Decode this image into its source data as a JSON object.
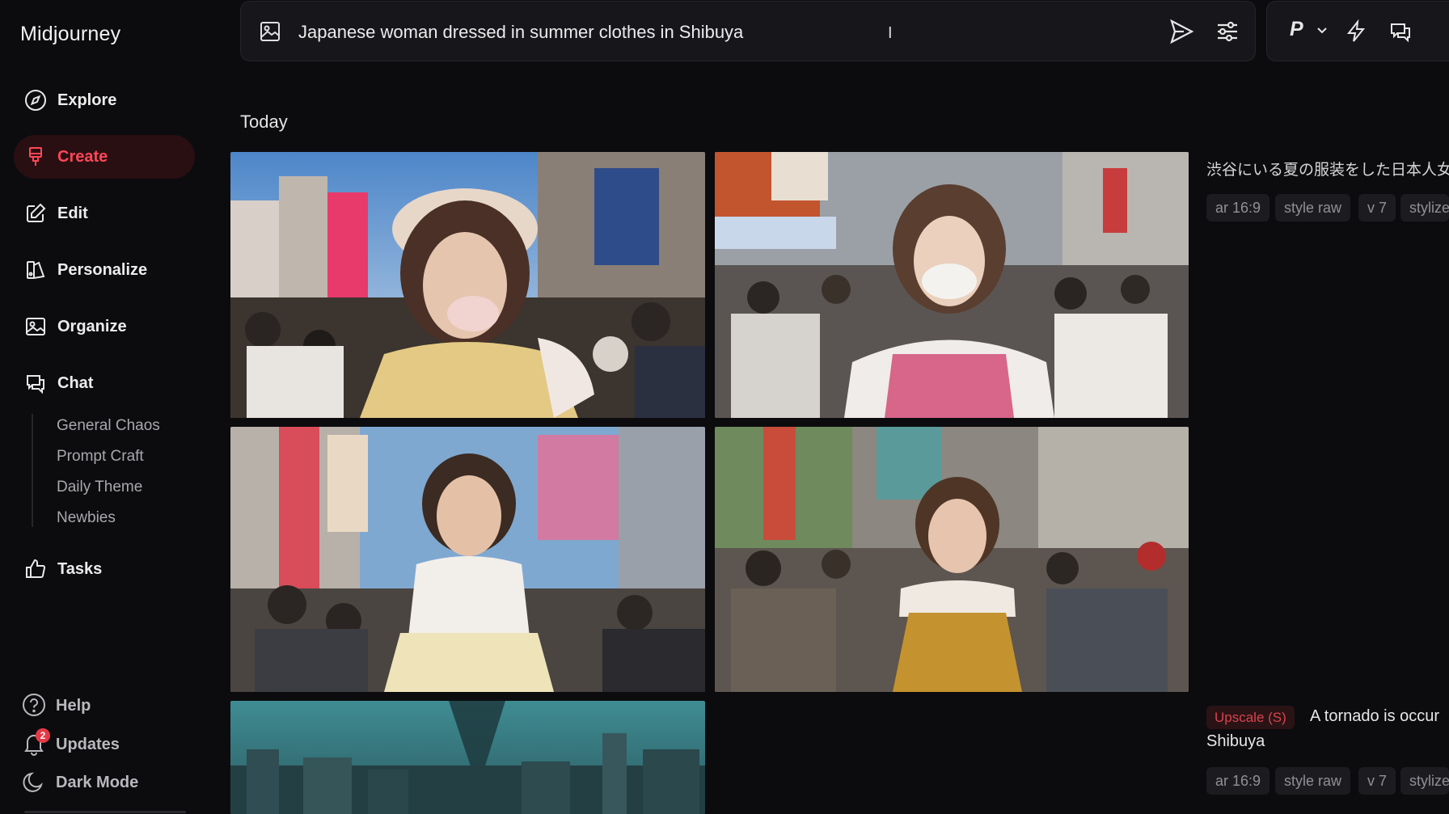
{
  "app": {
    "title": "Midjourney"
  },
  "sidebar": {
    "items": [
      {
        "label": "Explore",
        "icon": "compass-icon"
      },
      {
        "label": "Create",
        "icon": "brush-icon",
        "active": true
      },
      {
        "label": "Edit",
        "icon": "edit-icon"
      },
      {
        "label": "Personalize",
        "icon": "personalize-icon"
      },
      {
        "label": "Organize",
        "icon": "image-icon"
      },
      {
        "label": "Chat",
        "icon": "chat-icon"
      }
    ],
    "chat_rooms": [
      "General Chaos",
      "Prompt Craft",
      "Daily Theme",
      "Newbies"
    ],
    "tasks": {
      "label": "Tasks",
      "icon": "thumbs-up-icon"
    },
    "bottom": [
      {
        "label": "Help",
        "icon": "help-icon"
      },
      {
        "label": "Updates",
        "icon": "bell-icon",
        "badge": "2"
      },
      {
        "label": "Dark Mode",
        "icon": "moon-icon"
      }
    ]
  },
  "prompt_bar": {
    "value": "Japanese woman dressed in summer clothes in Shibuya",
    "icons": [
      "image-icon",
      "send-icon",
      "sliders-icon"
    ]
  },
  "toolbar": {
    "profile_label": "P",
    "icons": [
      "chevron-down-icon",
      "bolt-icon",
      "chat-bubbles-icon"
    ]
  },
  "feed": {
    "section_title": "Today",
    "job1": {
      "prompt": "渋谷にいる夏の服装をした日本人女",
      "params": [
        "ar 16:9",
        "style raw",
        "v 7",
        "stylize"
      ]
    },
    "job2": {
      "tag": "Upscale (S)",
      "prompt_line1": "A tornado is occur",
      "prompt_line2": "Shibuya",
      "params": [
        "ar 16:9",
        "style raw",
        "v 7",
        "stylize"
      ]
    }
  },
  "colors": {
    "accent": "#ff4757",
    "background": "#0c0c0f",
    "panel": "#17171b"
  }
}
